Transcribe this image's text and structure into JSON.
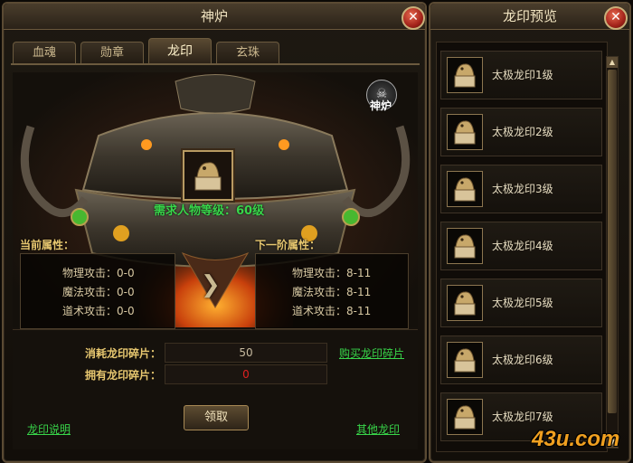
{
  "left_panel": {
    "title": "神炉",
    "close": "✕",
    "tabs": [
      {
        "label": "血魂",
        "active": false
      },
      {
        "label": "勋章",
        "active": false
      },
      {
        "label": "龙印",
        "active": true
      },
      {
        "label": "玄珠",
        "active": false
      }
    ],
    "furnace_badge": "神炉",
    "required_level": "需求人物等级：60级",
    "current": {
      "title": "当前属性：",
      "stats": [
        "物理攻击：0-0",
        "魔法攻击：0-0",
        "道术攻击：0-0"
      ]
    },
    "next": {
      "title": "下一阶属性：",
      "stats": [
        "物理攻击：8-11",
        "魔法攻击：8-11",
        "道术攻击：8-11"
      ]
    },
    "consume_label": "消耗龙印碎片：",
    "consume_value": "50",
    "own_label": "拥有龙印碎片：",
    "own_value": "0",
    "buy_link": "购买龙印碎片",
    "claim_button": "领取",
    "help_link": "龙印说明",
    "other_link": "其他龙印"
  },
  "right_panel": {
    "title": "龙印预览",
    "close": "✕",
    "items": [
      "太极龙印1级",
      "太极龙印2级",
      "太极龙印3级",
      "太极龙印4级",
      "太极龙印5级",
      "太极龙印6级",
      "太极龙印7级"
    ]
  },
  "watermark": "43u.com",
  "colors": {
    "green": "#38d64a",
    "gold": "#e8c870",
    "red": "#e02020"
  }
}
